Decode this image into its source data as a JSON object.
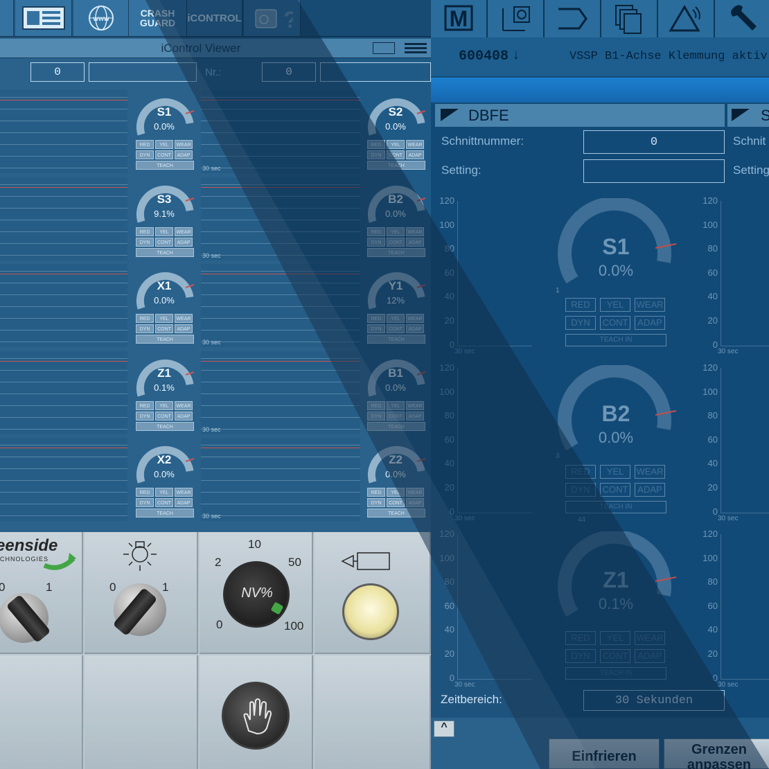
{
  "left_panel": {
    "toolbar": {
      "crash_guard": "CRASH GUARD",
      "icontrol": "iCONTROL",
      "www": "www"
    },
    "viewer_title": "iControl Viewer",
    "nr_row": {
      "value_left": "0",
      "label": "Nr.:",
      "value_right": "0"
    },
    "sec_label": "30 sec",
    "gauges_left": [
      {
        "name": "S1",
        "value": "0.0%"
      },
      {
        "name": "S3",
        "value": "9.1%"
      },
      {
        "name": "X1",
        "value": "0.0%"
      },
      {
        "name": "Z1",
        "value": "0.1%"
      },
      {
        "name": "X2",
        "value": "0.0%"
      }
    ],
    "gauges_right": [
      {
        "name": "S2",
        "value": "0.0%"
      },
      {
        "name": "B2",
        "value": "0.0%"
      },
      {
        "name": "Y1",
        "value": "12%"
      },
      {
        "name": "B1",
        "value": "0.0%"
      },
      {
        "name": "Z2",
        "value": "0.0%"
      }
    ],
    "chips": [
      "RED",
      "YEL",
      "WEAR",
      "DYN",
      "CONT",
      "ADAP"
    ],
    "teach": "TEACH",
    "operator_panel": {
      "logo": "eenside",
      "logo_sub": "CHNOLOGIES",
      "switch1": {
        "left": "0",
        "right": "1"
      },
      "switch2": {
        "left": "0",
        "right": "1"
      },
      "dial": {
        "top": "10",
        "left_top": "2",
        "right_top": "50",
        "left_bottom": "0",
        "right_bottom": "100",
        "center": "NV%"
      }
    }
  },
  "right_panel": {
    "alarm_number": "600408",
    "alarm_arrow": "↓",
    "alarm_text": "VSSP B1-Achse Klemmung aktiv",
    "section_title": "DBFE",
    "section_title2": "S",
    "fields": {
      "schnittnummer_label": "Schnittnummer:",
      "schnittnummer_value": "0",
      "schnitt_label2": "Schnit",
      "setting_label": "Setting:",
      "setting_value": "",
      "setting_label2": "Setting"
    },
    "axis_ticks": [
      "120",
      "100",
      "80",
      "60",
      "40",
      "20",
      "0"
    ],
    "sec_label": "30 sec",
    "gauges": [
      {
        "name": "S1",
        "value": "0.0%",
        "small": "1"
      },
      {
        "name": "B2",
        "value": "0.0%",
        "small": "3"
      },
      {
        "name": "Z1",
        "value": "0.1%",
        "small": "44"
      }
    ],
    "chips": [
      "RED",
      "YEL",
      "WEAR",
      "DYN",
      "CONT",
      "ADAP"
    ],
    "teach": "TEACH IN",
    "zeitbereich_label": "Zeitbereich:",
    "zeitbereich_value": "30 Sekunden",
    "softkeys": {
      "einfrieren": "Einfrieren",
      "grenzen": "Grenzen anpassen"
    },
    "scroll_up": "^"
  },
  "colors": {
    "panel_dark": "#124a77",
    "accent_blue": "#1d7fd1",
    "limit_red": "#c44d4d"
  }
}
